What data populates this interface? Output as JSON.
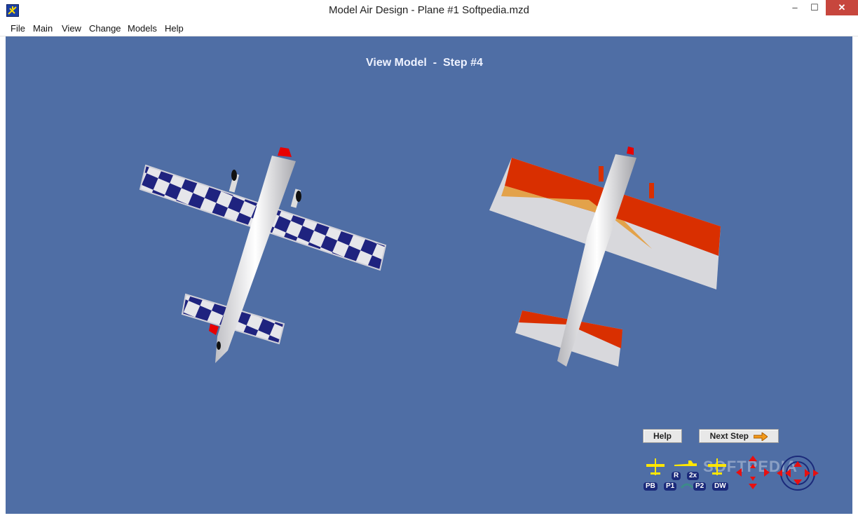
{
  "window": {
    "title": "Model Air Design - Plane #1  Softpedia.mzd",
    "controls": {
      "minimize": "–",
      "maximize": "☐",
      "close": "✕"
    }
  },
  "menu": [
    "File",
    "Main",
    "View",
    "Change",
    "Models",
    "Help"
  ],
  "viewport": {
    "title": "View Model  -  Step #4"
  },
  "buttons": {
    "help": "Help",
    "next_step": "Next Step"
  },
  "controls": {
    "pb": "PB",
    "p1": "P1",
    "p2": "P2",
    "dw": "DW",
    "r": "R",
    "two_x": "2x"
  },
  "watermark": "SOFTPEDIA",
  "colors": {
    "background": "#4f6ea5",
    "checker_blue": "#1f237f",
    "wing_orange": "#d92f00",
    "accent_yellow": "#ffe600"
  }
}
